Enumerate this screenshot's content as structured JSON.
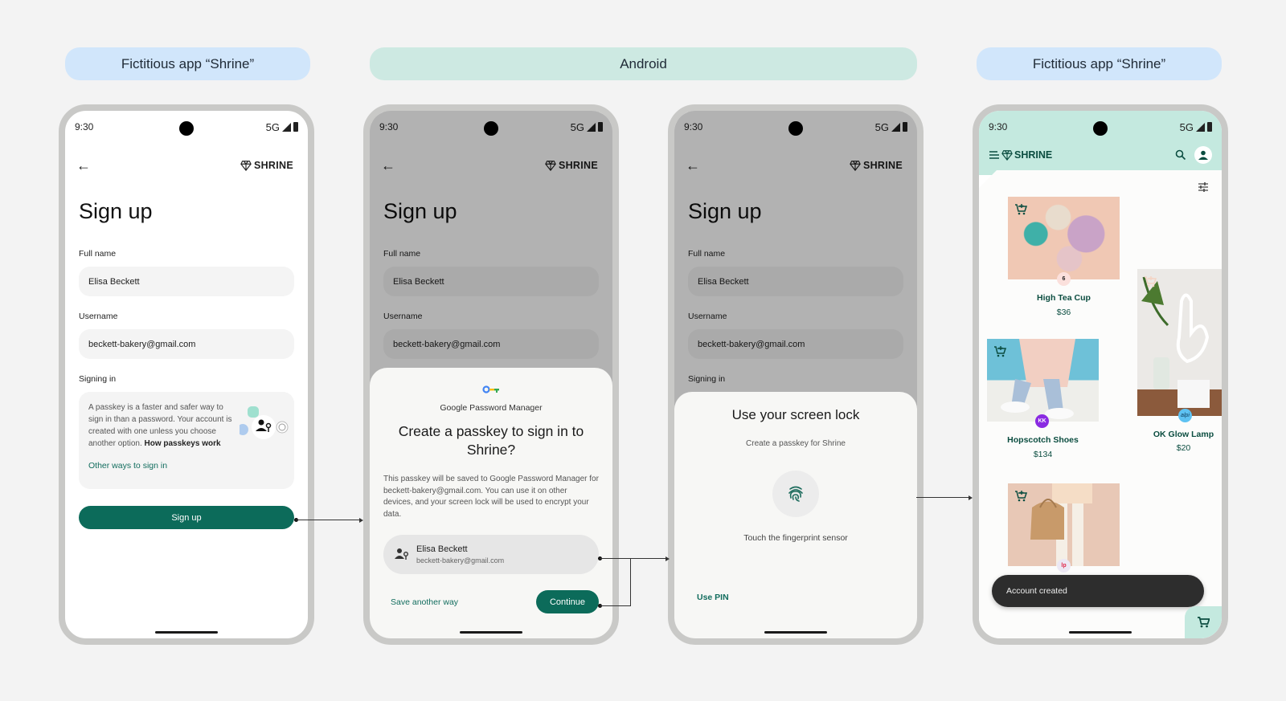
{
  "headers": {
    "left": "Fictitious app “Shrine”",
    "middle": "Android",
    "right": "Fictitious app “Shrine”"
  },
  "status_bar": {
    "time": "9:30",
    "network": "5G"
  },
  "brand": {
    "name": "SHRINE"
  },
  "signup_form": {
    "title": "Sign up",
    "full_name_label": "Full name",
    "full_name_value": "Elisa Beckett",
    "username_label": "Username",
    "username_value": "beckett-bakery@gmail.com",
    "signing_in_label": "Signing in",
    "passkey_info": "A passkey is a faster and safer way to sign in than a password. Your account is created with one unless you choose another option. ",
    "passkey_link": "How passkeys work",
    "other_ways": "Other ways to sign in",
    "signup_button": "Sign up"
  },
  "password_manager_sheet": {
    "provider": "Google Password Manager",
    "title": "Create a passkey to sign in to Shrine?",
    "body": "This passkey will be saved to Google Password Manager for beckett-bakery@gmail.com. You can use it on other devices, and your screen lock will be used to encrypt your data.",
    "account_name": "Elisa Beckett",
    "account_email": "beckett-bakery@gmail.com",
    "save_another_way": "Save another way",
    "continue_button": "Continue"
  },
  "screen_lock_sheet": {
    "title": "Use your screen lock",
    "subtitle": "Create a passkey for Shrine",
    "instruction": "Touch the fingerprint sensor",
    "use_pin": "Use PIN"
  },
  "shrine_home": {
    "products": [
      {
        "name": "High Tea Cup",
        "price": "$36",
        "vendor_badge": "6"
      },
      {
        "name": "OK Glow Lamp",
        "price": "$20",
        "vendor_badge": "alpi"
      },
      {
        "name": "Hopscotch Shoes",
        "price": "$134",
        "vendor_badge": "KK"
      },
      {
        "name": "",
        "price": "",
        "vendor_badge": "lp"
      }
    ],
    "snackbar": "Account created"
  },
  "colors": {
    "accent": "#0c6b5a",
    "shrine_mint": "#c4e9df",
    "header_blue": "#d1e6fb",
    "header_teal": "#cde9e2"
  }
}
